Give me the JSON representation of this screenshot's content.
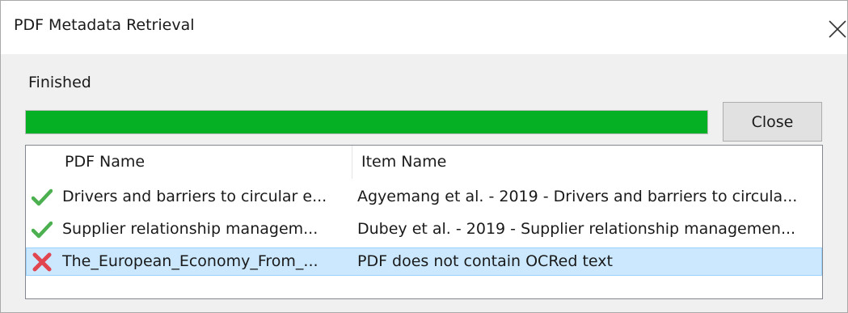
{
  "window": {
    "title": "PDF Metadata Retrieval"
  },
  "status": {
    "text": "Finished",
    "progress_percent": 100,
    "progress_color": "#06b025"
  },
  "buttons": {
    "close_label": "Close"
  },
  "table": {
    "headers": {
      "pdf_name": "PDF Name",
      "item_name": "Item Name"
    },
    "rows": [
      {
        "status_icon": "check-icon",
        "pdf_name": "Drivers and barriers to circular e...",
        "item_name": "Agyemang et al. - 2019 - Drivers and barriers to circula...",
        "selected": false
      },
      {
        "status_icon": "check-icon",
        "pdf_name": "Supplier relationship managem...",
        "item_name": "Dubey et al. - 2019 - Supplier relationship managemen...",
        "selected": false
      },
      {
        "status_icon": "error-icon",
        "pdf_name": "The_European_Economy_From_...",
        "item_name": "PDF does not contain OCRed text",
        "selected": true
      }
    ]
  },
  "colors": {
    "success": "#4caf50",
    "error": "#e04550",
    "selection": "#cce8ff"
  }
}
